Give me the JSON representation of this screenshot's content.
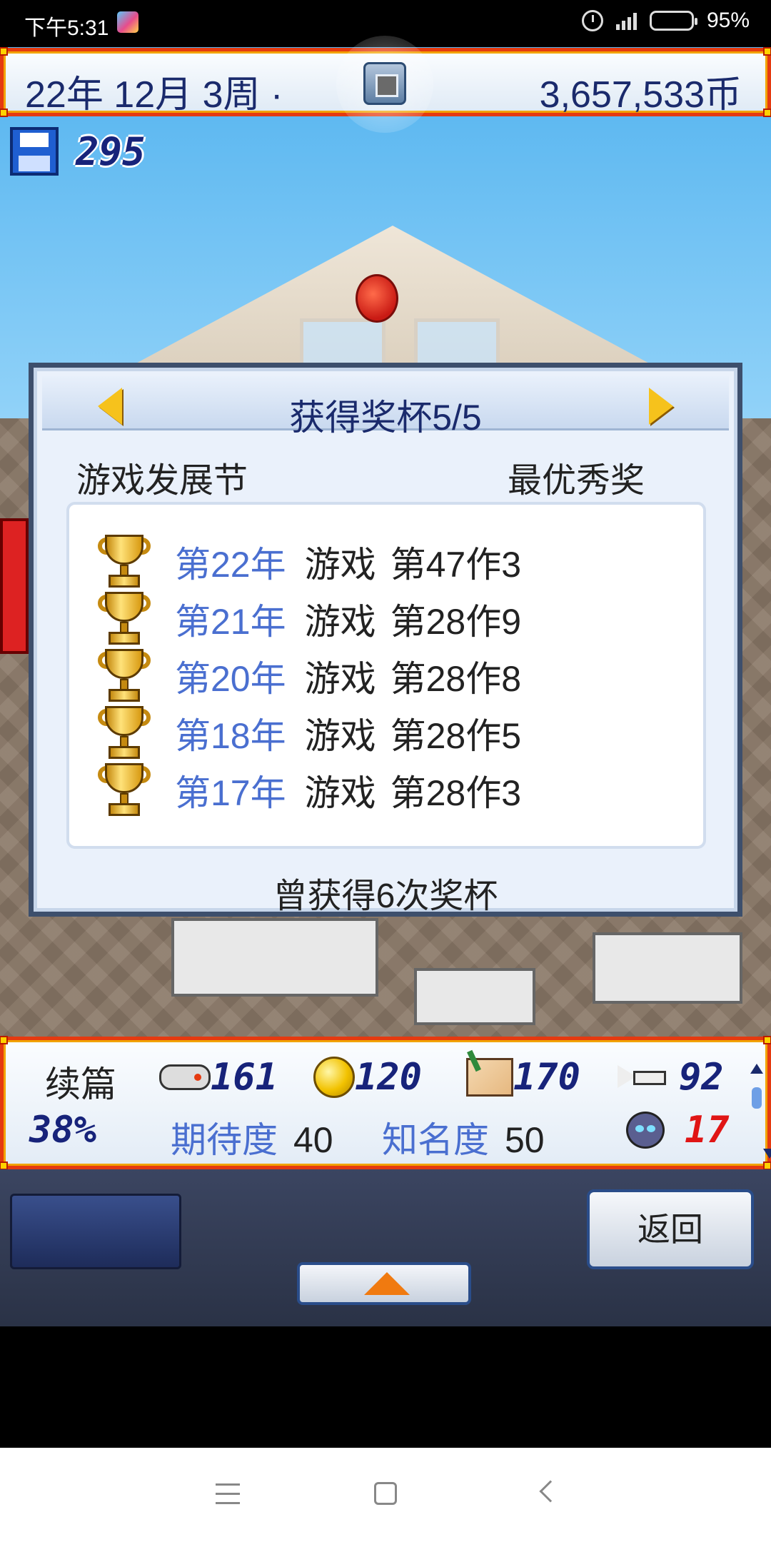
{
  "status_bar": {
    "time": "下午5:31",
    "battery": "95%",
    "battery_level": 0.95
  },
  "top_bar": {
    "date": "22年 12月 3周 ·",
    "coins": "3,657,533币"
  },
  "save": {
    "count": "295"
  },
  "dialog": {
    "title": "获得奖杯5/5",
    "festival": "游戏发展节",
    "award": "最优秀奖",
    "trophies": [
      {
        "year": "第22年",
        "type": "游戏",
        "work": "第47作3"
      },
      {
        "year": "第21年",
        "type": "游戏",
        "work": "第28作9"
      },
      {
        "year": "第20年",
        "type": "游戏",
        "work": "第28作8"
      },
      {
        "year": "第18年",
        "type": "游戏",
        "work": "第28作5"
      },
      {
        "year": "第17年",
        "type": "游戏",
        "work": "第28作3"
      }
    ],
    "footer": "曾获得6次奖杯"
  },
  "stats": {
    "label": "续篇",
    "percent": "38%",
    "fun": "161",
    "creativity": "120",
    "graphics": "170",
    "sound": "92",
    "bugs": "17",
    "expectation_label": "期待度",
    "expectation_value": "40",
    "fame_label": "知名度",
    "fame_value": "50"
  },
  "controls": {
    "back_label": "返回"
  },
  "colors": {
    "frame_red": "#e53a10",
    "frame_gold": "#f2a300",
    "navy_text": "#1a2a6c",
    "year_blue": "#4a6fd0",
    "bug_red": "#e01515",
    "trophy_gold": "#f2c200"
  },
  "icons": {
    "save": "floppy-disk-icon",
    "trophy": "trophy-icon",
    "fun": "gamepad-icon",
    "creativity": "coin-icon",
    "graphics": "brush-icon",
    "sound": "trumpet-icon",
    "bugs": "bug-icon",
    "prev": "left-arrow-icon",
    "next": "right-arrow-icon",
    "up": "up-arrow-icon"
  }
}
